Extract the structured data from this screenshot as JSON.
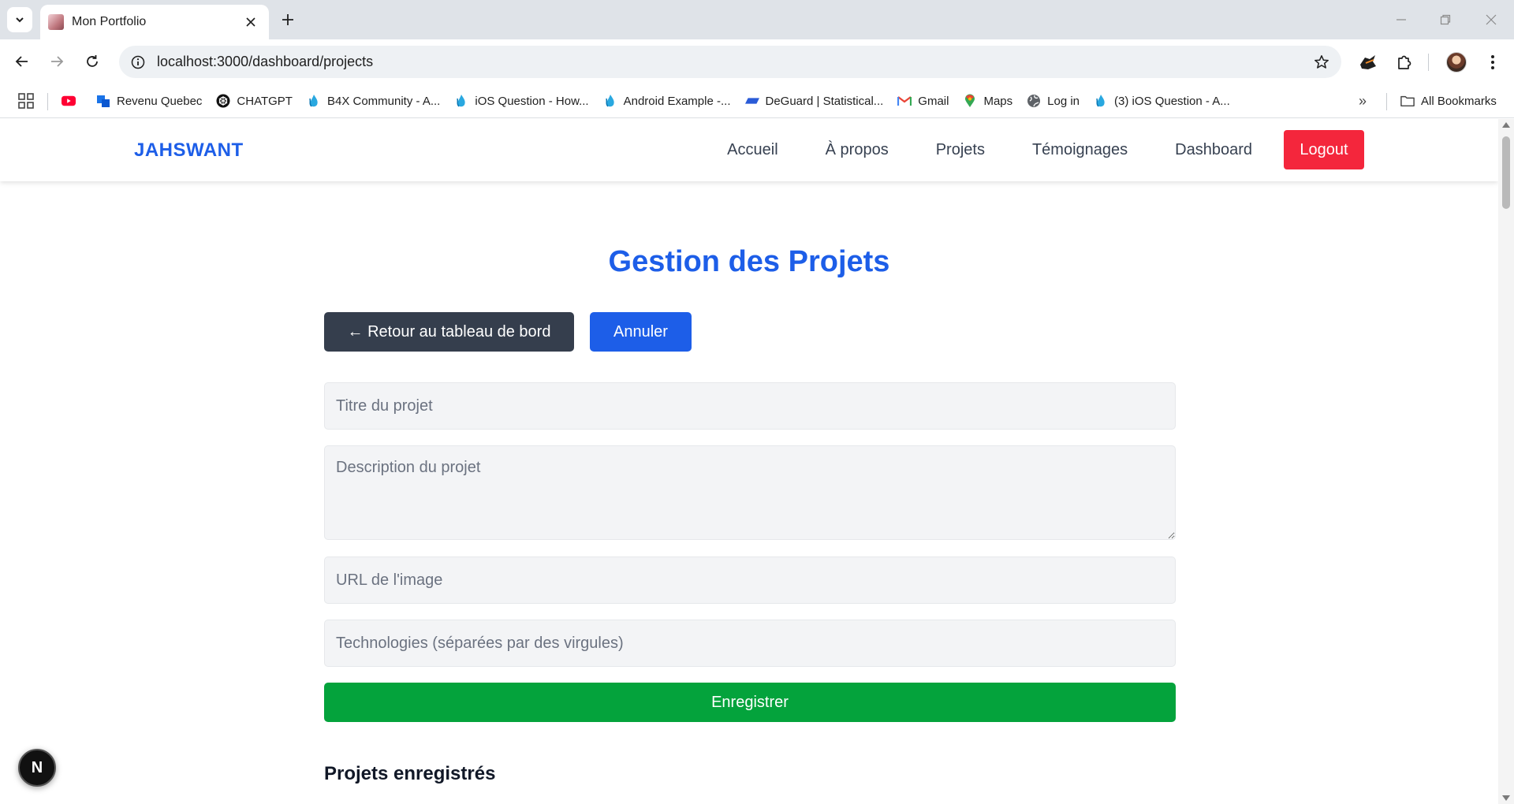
{
  "browser": {
    "tab_title": "Mon Portfolio",
    "url": "localhost:3000/dashboard/projects",
    "bookmarks": [
      {
        "label": "",
        "icon": "youtube-icon"
      },
      {
        "label": "Revenu Quebec",
        "icon": "revenu-quebec-icon"
      },
      {
        "label": "CHATGPT",
        "icon": "chatgpt-icon"
      },
      {
        "label": "B4X Community - A...",
        "icon": "b4x-icon"
      },
      {
        "label": "iOS Question - How...",
        "icon": "b4x-icon"
      },
      {
        "label": "Android Example -...",
        "icon": "b4x-icon"
      },
      {
        "label": "DeGuard | Statistical...",
        "icon": "deguard-icon"
      },
      {
        "label": "Gmail",
        "icon": "gmail-icon"
      },
      {
        "label": "Maps",
        "icon": "maps-icon"
      },
      {
        "label": "Log in",
        "icon": "globe-icon"
      },
      {
        "label": "(3) iOS Question - A...",
        "icon": "b4x-icon"
      }
    ],
    "all_bookmarks_label": "All Bookmarks"
  },
  "site": {
    "brand": "JAHSWANT",
    "nav": {
      "home": "Accueil",
      "about": "À propos",
      "projects": "Projets",
      "testimonials": "Témoignages",
      "dashboard": "Dashboard",
      "logout": "Logout"
    },
    "colors": {
      "accent": "#1d5ee8",
      "logout": "#f4263c",
      "save": "#04a33c",
      "back_button": "#353e4d"
    }
  },
  "main": {
    "title": "Gestion des Projets",
    "back_button": "← Retour au tableau de bord",
    "cancel_button": "Annuler",
    "form": {
      "title_placeholder": "Titre du projet",
      "description_placeholder": "Description du projet",
      "image_url_placeholder": "URL de l'image",
      "technologies_placeholder": "Technologies (séparées par des virgules)",
      "title_value": "",
      "description_value": "",
      "image_url_value": "",
      "technologies_value": ""
    },
    "save_button": "Enregistrer",
    "saved_projects_heading": "Projets enregistrés"
  },
  "dev_badge": "N"
}
